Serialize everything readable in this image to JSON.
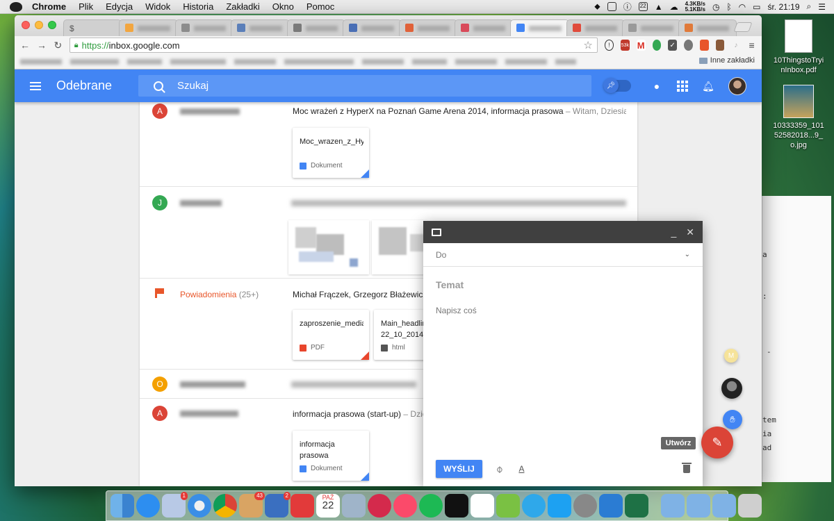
{
  "menubar": {
    "app_name": "Chrome",
    "menus": [
      "Plik",
      "Edycja",
      "Widok",
      "Historia",
      "Zakładki",
      "Okno",
      "Pomoc"
    ],
    "net_up": "4.3KB/s",
    "net_down": "5.1KB/s",
    "calendar_day": "22",
    "clock": "śr. 21:19"
  },
  "browser": {
    "url_scheme": "https://",
    "url_host": "inbox.google.com",
    "bookmarks_folder": "Inne zakładki",
    "ext_badges": {
      "counter": "53k",
      "gmail": "1"
    }
  },
  "inbox": {
    "title": "Odebrane",
    "search_placeholder": "Szukaj",
    "rows": [
      {
        "avatar": "A",
        "avatar_color": "#db4437",
        "subject": "Moc wrażeń z HyperX na Poznań Game Arena 2014, informacja prasowa",
        "snippet": " – Witam, Dziesiątki ty...",
        "attachments": [
          {
            "name": "Moc_wrazen_z_Hy",
            "type": "Dokument"
          }
        ]
      },
      {
        "avatar": "J",
        "avatar_color": "#34a853"
      },
      {
        "bundle_name": "Powiadomienia",
        "bundle_count": "(25+)",
        "subject": "Michał Frączek, Grzegorz Błażewicz, A",
        "attachments": [
          {
            "name": "zaproszenie_media",
            "type": "PDF"
          },
          {
            "name": "Main_headlin 22_10_2014",
            "type": "html"
          }
        ]
      },
      {
        "avatar": "O",
        "avatar_color": "#f4a000"
      },
      {
        "avatar": "A",
        "avatar_color": "#db4437",
        "subject": "informacja prasowa (start-up)",
        "snippet": " – Dzień d",
        "attachments": [
          {
            "name": "informacja prasowa",
            "type": "Dokument"
          }
        ]
      }
    ]
  },
  "compose": {
    "to_label": "Do",
    "subject_placeholder": "Temat",
    "body_placeholder": "Napisz coś",
    "send_label": "WYŚLIJ"
  },
  "fab": {
    "tooltip": "Utwórz",
    "reminder_initial": "M"
  },
  "desktop": {
    "file1": "10ThingstoTryinInbox.pdf",
    "file2": "10333359_10152582018...9_o.jpg"
  },
  "dock": {
    "badge_mail": "1",
    "badge_store": "43",
    "badge_tasks": "2",
    "calendar_month": "PAŹ",
    "calendar_day": "22"
  }
}
